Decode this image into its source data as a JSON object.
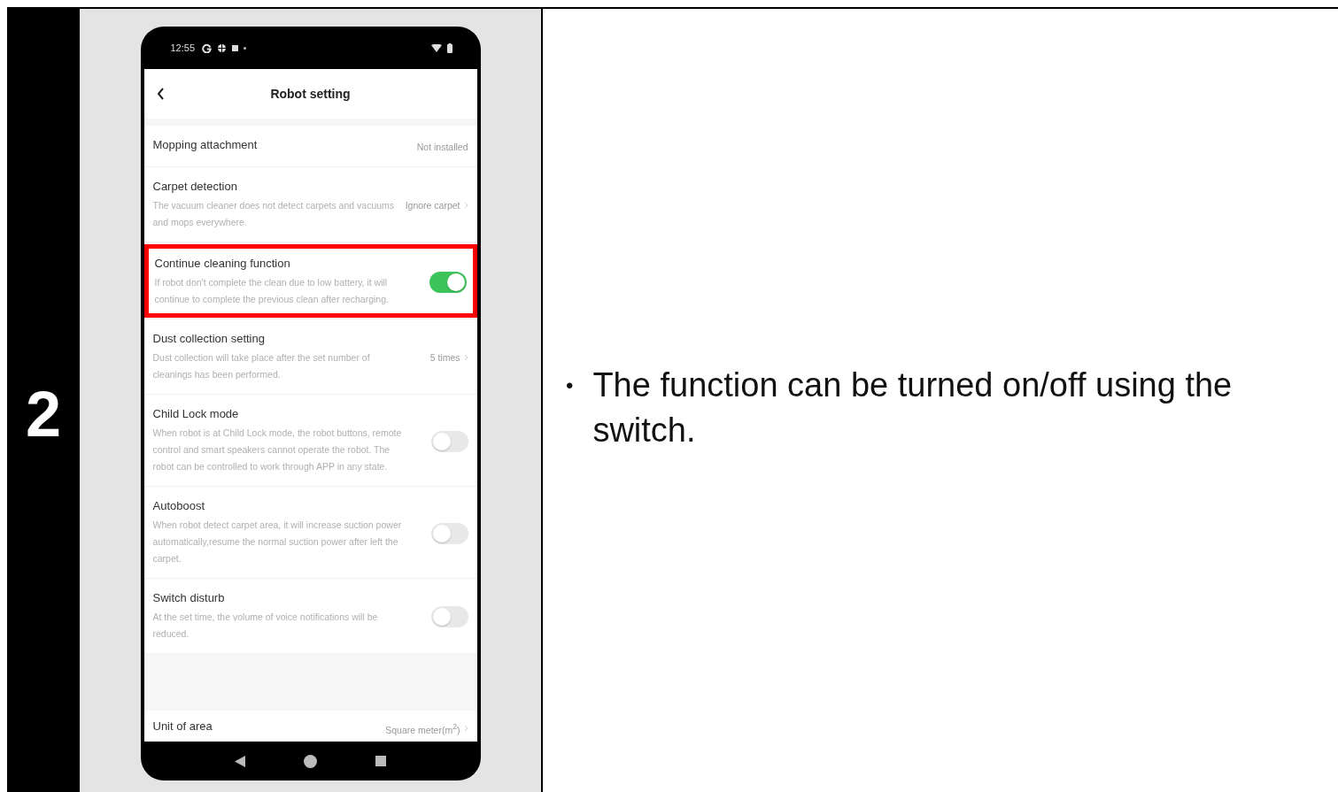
{
  "step": {
    "number": "2"
  },
  "phone": {
    "status_bar": {
      "time": "12:55"
    },
    "header": {
      "title": "Robot setting"
    },
    "settings": [
      {
        "kind": "value",
        "title": "Mopping attachment",
        "value": "Not installed",
        "chevron": false,
        "highlighted": false
      },
      {
        "kind": "value",
        "title": "Carpet detection",
        "description": "The vacuum cleaner does not detect carpets and vacuums and mops everywhere.",
        "value": "Ignore carpet",
        "chevron": true,
        "highlighted": false
      },
      {
        "kind": "toggle",
        "title": "Continue cleaning function",
        "description": "If robot don't complete the clean due to low battery, it will continue to complete the previous clean after recharging.",
        "on": true,
        "highlighted": true
      },
      {
        "kind": "value",
        "title": "Dust collection setting",
        "description": "Dust collection will take place after the set number of cleanings has been performed.",
        "value": "5 times",
        "chevron": true,
        "highlighted": false
      },
      {
        "kind": "toggle",
        "title": "Child Lock mode",
        "description": "When robot is at Child Lock mode, the robot buttons, remote control and smart speakers cannot operate the robot. The robot can be controlled to work through APP in any state.",
        "on": false,
        "highlighted": false
      },
      {
        "kind": "toggle",
        "title": "Autoboost",
        "description": "When robot detect carpet area, it will increase suction power automatically,resume the normal suction power after left the carpet.",
        "on": false,
        "highlighted": false
      },
      {
        "kind": "toggle",
        "title": "Switch disturb",
        "description": "At the set time, the volume of voice notifications will be reduced.",
        "on": false,
        "highlighted": false
      },
      {
        "kind": "value",
        "title": "Unit of area",
        "value": "Square meter(m$^{2}$)",
        "chevron": true,
        "highlighted": false,
        "separated": true
      }
    ]
  },
  "instructions": [
    {
      "bullet": "•",
      "text": "The function can be turned on/off using the switch."
    }
  ]
}
